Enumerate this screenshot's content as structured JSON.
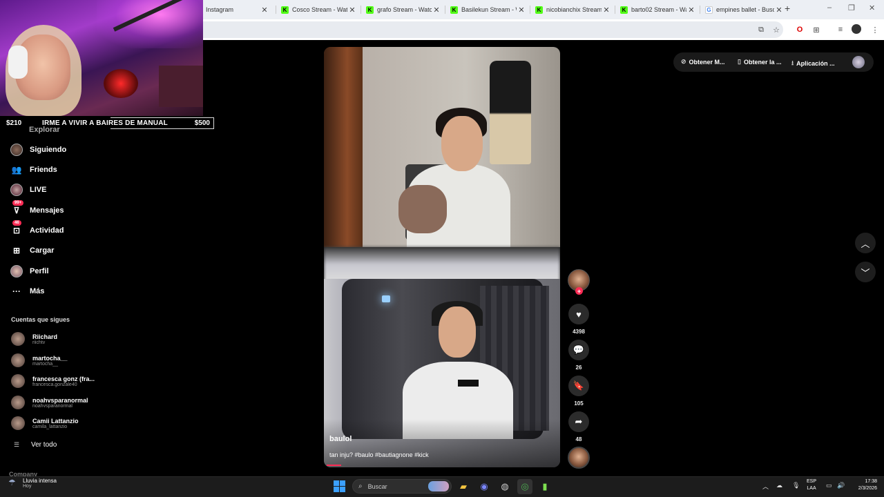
{
  "browser": {
    "tabs": [
      {
        "title": "Instagram",
        "fav": "",
        "kind": "none"
      },
      {
        "title": "Cosco Stream - Watch",
        "fav": "K",
        "kind": "kick"
      },
      {
        "title": "grafo Stream - Watch",
        "fav": "K",
        "kind": "kick"
      },
      {
        "title": "Basilekun Stream - W",
        "fav": "K",
        "kind": "kick"
      },
      {
        "title": "nicobianchix Stream",
        "fav": "K",
        "kind": "kick"
      },
      {
        "title": "barto02 Stream - Wat",
        "fav": "K",
        "kind": "kick"
      },
      {
        "title": "empines ballet - Busc",
        "fav": "G",
        "kind": "google"
      }
    ],
    "new_tab": "+",
    "close_glyph": "✕",
    "window_controls": [
      "–",
      "❐",
      "✕"
    ]
  },
  "stream_overlay": {
    "goal_current": "$210",
    "goal_text": "IRME A VIVIR A BAIRES DE MANUAL",
    "goal_target": "$500",
    "goal_fraction": 0.42
  },
  "sidebar": {
    "partial_top": "Explorar",
    "items": [
      {
        "label": "Siguiendo",
        "icon": "following-avatar-icon",
        "badge": ""
      },
      {
        "label": "Friends",
        "icon": "friends-icon",
        "badge": ""
      },
      {
        "label": "LIVE",
        "icon": "live-avatar-icon",
        "badge": ""
      },
      {
        "label": "Mensajes",
        "icon": "messages-icon",
        "badge": "99+"
      },
      {
        "label": "Actividad",
        "icon": "activity-icon",
        "badge": "46"
      },
      {
        "label": "Cargar",
        "icon": "upload-icon",
        "badge": ""
      },
      {
        "label": "Perfil",
        "icon": "profile-avatar-icon",
        "badge": ""
      },
      {
        "label": "Más",
        "icon": "more-icon",
        "badge": ""
      }
    ],
    "following_title": "Cuentas que sigues",
    "accounts": [
      {
        "name": "Riichard",
        "handle": "riichtv"
      },
      {
        "name": "martocha__",
        "handle": "martocha__"
      },
      {
        "name": "francesca gonz (fra...",
        "handle": "francesca.gonzale40"
      },
      {
        "name": "noahvsparanormal",
        "handle": "noahvsparanormal"
      },
      {
        "name": "Camii Lattanzio",
        "handle": "camila_lattanzio"
      }
    ],
    "see_all": "Ver todo",
    "company": "Company"
  },
  "video": {
    "author": "baulol",
    "caption": "tan inju? #baulo #bautiagnone #kick",
    "progress_fraction": 0.06
  },
  "actions": {
    "follow_plus": "+",
    "likes": "4398",
    "comments": "26",
    "saves": "105",
    "shares": "48"
  },
  "top_pills": {
    "coins": "Obtener M...",
    "app": "Obtener la ...",
    "desktop": "Aplicación ..."
  },
  "taskbar": {
    "weather_title": "Lluvia intensa",
    "weather_sub": "Hoy",
    "search_placeholder": "Buscar",
    "lang_1": "ESP",
    "lang_2": "LAA",
    "time": "17:38",
    "date": "2/3/2026"
  },
  "colors": {
    "accent": "#fe2c55",
    "kick": "#53fc18",
    "goal_fill": "#d03ad0"
  }
}
